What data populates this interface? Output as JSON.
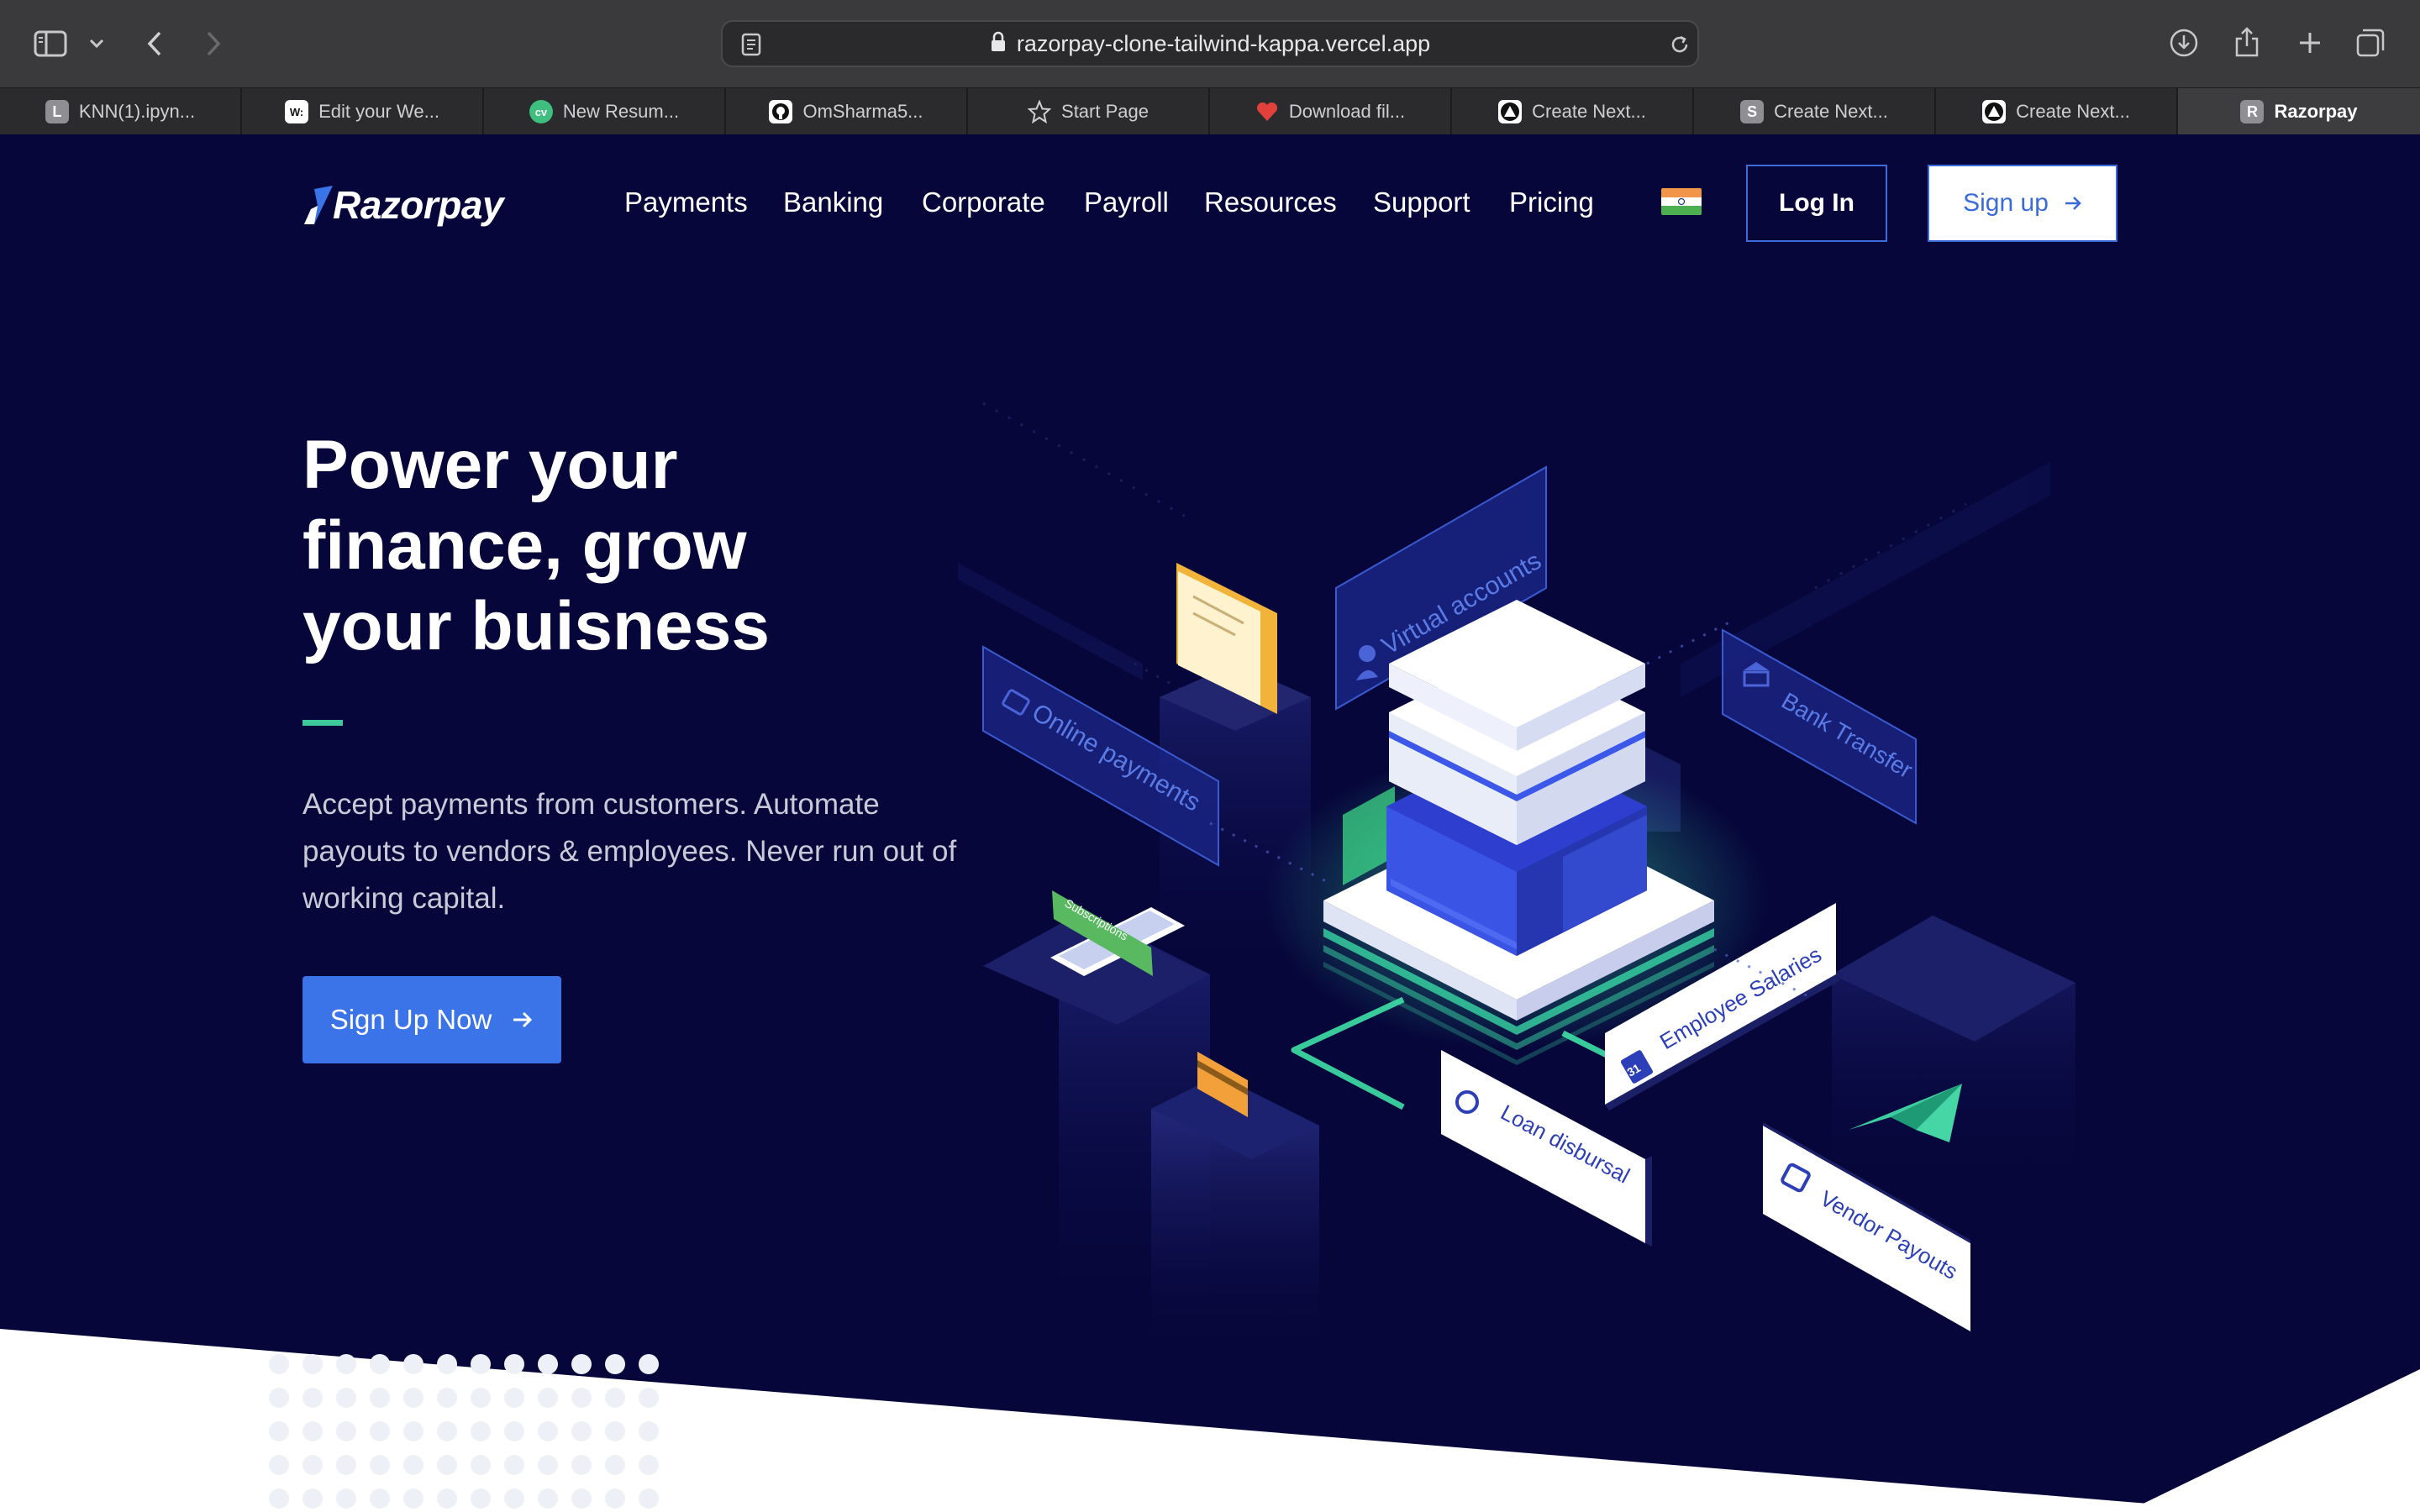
{
  "browser": {
    "url": "razorpay-clone-tailwind-kappa.vercel.app",
    "tabs": [
      {
        "label": "KNN(1).ipyn...",
        "favicon": "L",
        "favicon_bg": "#8e8e93"
      },
      {
        "label": "Edit your We...",
        "favicon": "W:",
        "favicon_bg": "#ffffff"
      },
      {
        "label": "New Resum...",
        "favicon": "cv",
        "favicon_bg": "#3fbf7f"
      },
      {
        "label": "OmSharma5...",
        "favicon": "github-icon",
        "favicon_bg": "#ffffff"
      },
      {
        "label": "Start Page",
        "favicon": "star-icon",
        "favicon_bg": "transparent"
      },
      {
        "label": "Download fil...",
        "favicon": "heart-icon",
        "favicon_bg": "transparent"
      },
      {
        "label": "Create Next...",
        "favicon": "triangle-icon",
        "favicon_bg": "#ffffff"
      },
      {
        "label": "Create Next...",
        "favicon": "S",
        "favicon_bg": "#8e8e93"
      },
      {
        "label": "Create Next...",
        "favicon": "triangle-icon",
        "favicon_bg": "#ffffff"
      },
      {
        "label": "Razorpay",
        "favicon": "R",
        "favicon_bg": "#8e8e93"
      }
    ]
  },
  "header": {
    "logo": "Razorpay",
    "nav": [
      "Payments",
      "Banking",
      "Corporate",
      "Payroll",
      "Resources",
      "Support",
      "Pricing"
    ],
    "login_label": "Log In",
    "signup_label": "Sign up"
  },
  "hero": {
    "title_line1": "Power your",
    "title_line2": "finance, grow",
    "title_line3": "your buisness",
    "subtitle": "Accept payments from customers. Automate payouts to vendors & employees. Never run out of working capital.",
    "cta_label": "Sign Up Now"
  },
  "illustration": {
    "labels": {
      "virtual_accounts": "Virtual accounts",
      "online_payments": "Online payments",
      "bank_transfer": "Bank Transfer",
      "subscriptions": "Subscriptions",
      "employee_salaries": "Employee Salaries",
      "loan_disbursal": "Loan disbursal",
      "vendor_payouts": "Vendor Payouts",
      "calendar_day": "31"
    }
  },
  "colors": {
    "page_bg": "#06063a",
    "accent_blue": "#3b73e8",
    "accent_green": "#3fc89a",
    "chrome_bg": "#3a3a3c"
  }
}
